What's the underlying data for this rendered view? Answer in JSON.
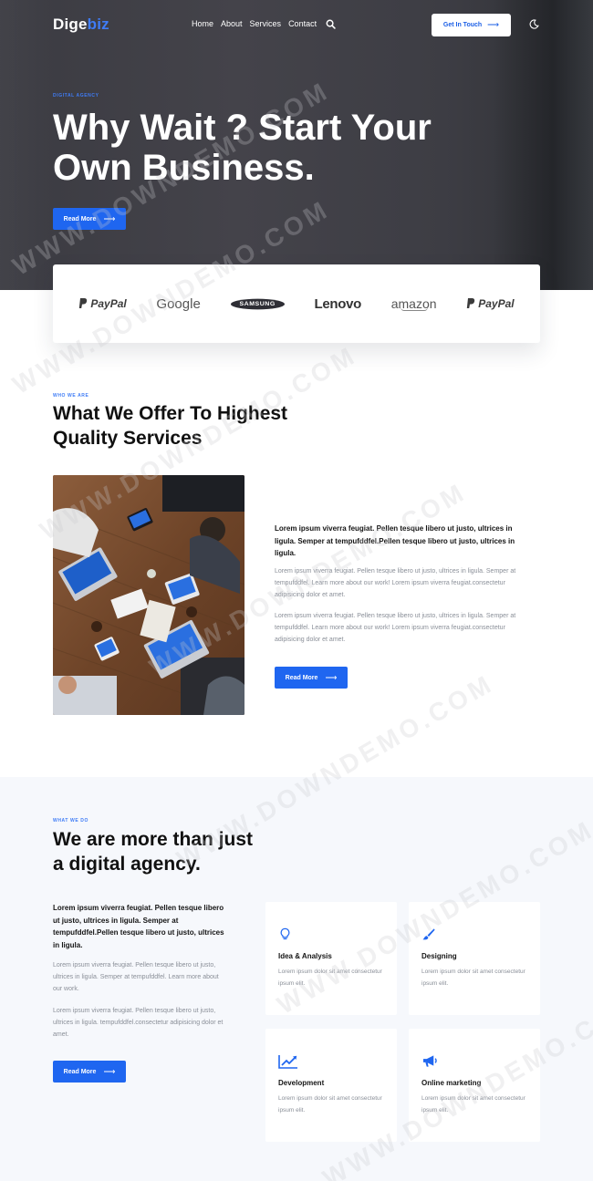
{
  "header": {
    "logo_main": "Dige",
    "logo_accent": "biz",
    "nav": [
      "Home",
      "About",
      "Services",
      "Contact"
    ],
    "cta_label": "Get In Touch"
  },
  "hero": {
    "eyebrow": "DIGITAL AGENCY",
    "title_line1": "Why Wait ? Start Your",
    "title_line2": "Own Business.",
    "button_label": "Read More"
  },
  "brands": [
    "PayPal",
    "Google",
    "SAMSUNG",
    "Lenovo",
    "amazon",
    "PayPal"
  ],
  "about": {
    "eyebrow": "WHO WE ARE",
    "title_line1": "What We Offer To Highest",
    "title_line2": "Quality Services",
    "lead": "Lorem ipsum viverra feugiat. Pellen tesque libero ut justo, ultrices in ligula. Semper at tempufddfel.Pellen tesque libero ut justo, ultrices in ligula.",
    "para1": "Lorem ipsum viverra feugiat. Pellen tesque libero ut justo, ultrices in ligula. Semper at tempufddfel. Learn more about our work! Lorem ipsum viverra feugiat.consectetur adipisicing dolor et amet.",
    "para2": "Lorem ipsum viverra feugiat. Pellen tesque libero ut justo, ultrices in ligula. Semper at tempufddfel. Learn more about our work! Lorem ipsum viverra feugiat.consectetur adipisicing dolor et amet.",
    "button_label": "Read More"
  },
  "services": {
    "eyebrow": "WHAT WE DO",
    "title_line1": "We are more than just",
    "title_line2": "a digital agency.",
    "lead": "Lorem ipsum viverra feugiat. Pellen tesque libero ut justo, ultrices in ligula. Semper at tempufddfel.Pellen tesque libero ut justo, ultrices in ligula.",
    "para1": "Lorem ipsum viverra feugiat. Pellen tesque libero ut justo, ultrices in ligula. Semper at tempufddfel. Learn more about our work.",
    "para2": "Lorem ipsum viverra feugiat. Pellen tesque libero ut justo, ultrices in ligula. tempufddfel.consectetur adipisicing dolor et amet.",
    "button_label": "Read More",
    "cards": [
      {
        "title": "Idea & Analysis",
        "desc": "Lorem ipsum dolor sit amet consectetur ipsum elit.",
        "icon": "lightbulb-icon"
      },
      {
        "title": "Designing",
        "desc": "Lorem ipsum dolor sit amet consectetur ipsum elit.",
        "icon": "paintbrush-icon"
      },
      {
        "title": "Development",
        "desc": "Lorem ipsum dolor sit amet consectetur ipsum elit.",
        "icon": "chart-line-icon"
      },
      {
        "title": "Online marketing",
        "desc": "Lorem ipsum dolor sit amet consectetur ipsum elit.",
        "icon": "megaphone-icon"
      }
    ]
  },
  "watermark": "WWW.DOWNDEMO.COM",
  "colors": {
    "accent": "#1f66f0",
    "hero_bg": "#404047",
    "section_bg": "#f6f8fc"
  }
}
